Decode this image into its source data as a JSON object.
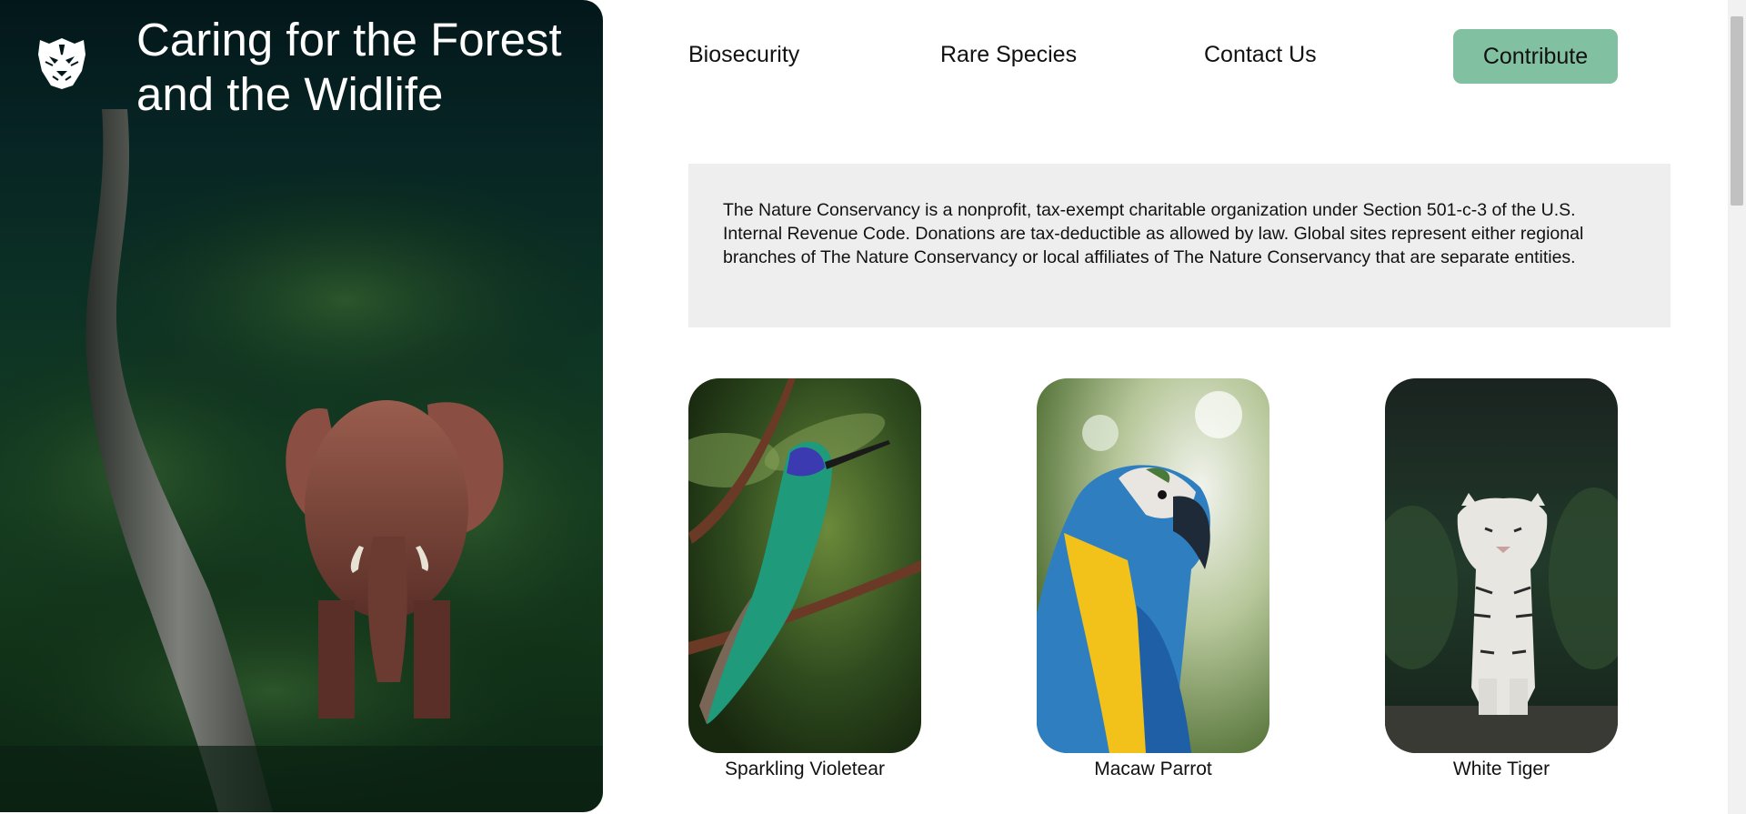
{
  "hero": {
    "title": "Caring for the Forest and the Widlife",
    "logo_icon": "tiger-head-icon",
    "image": "elephant-in-forest"
  },
  "nav": {
    "links": [
      "Biosecurity",
      "Rare Species",
      "Contact Us"
    ],
    "cta_label": "Contribute"
  },
  "disclaimer": {
    "text": "The Nature Conservancy is a nonprofit, tax-exempt charitable organization under Section 501-c-3 of the U.S. Internal Revenue Code. Donations are tax-deductible as allowed by law. Global sites represent either regional branches of The Nature Conservancy or local affiliates of The Nature Conservancy that are separate entities."
  },
  "cards": [
    {
      "label": "Sparkling Violetear",
      "image": "hummingbird-photo"
    },
    {
      "label": "Macaw Parrot",
      "image": "macaw-photo"
    },
    {
      "label": "White Tiger",
      "image": "white-tiger-photo"
    }
  ],
  "colors": {
    "accent": "#81c0a0",
    "panel_bg": "#eeeeee",
    "hero_dark": "#03171a"
  }
}
